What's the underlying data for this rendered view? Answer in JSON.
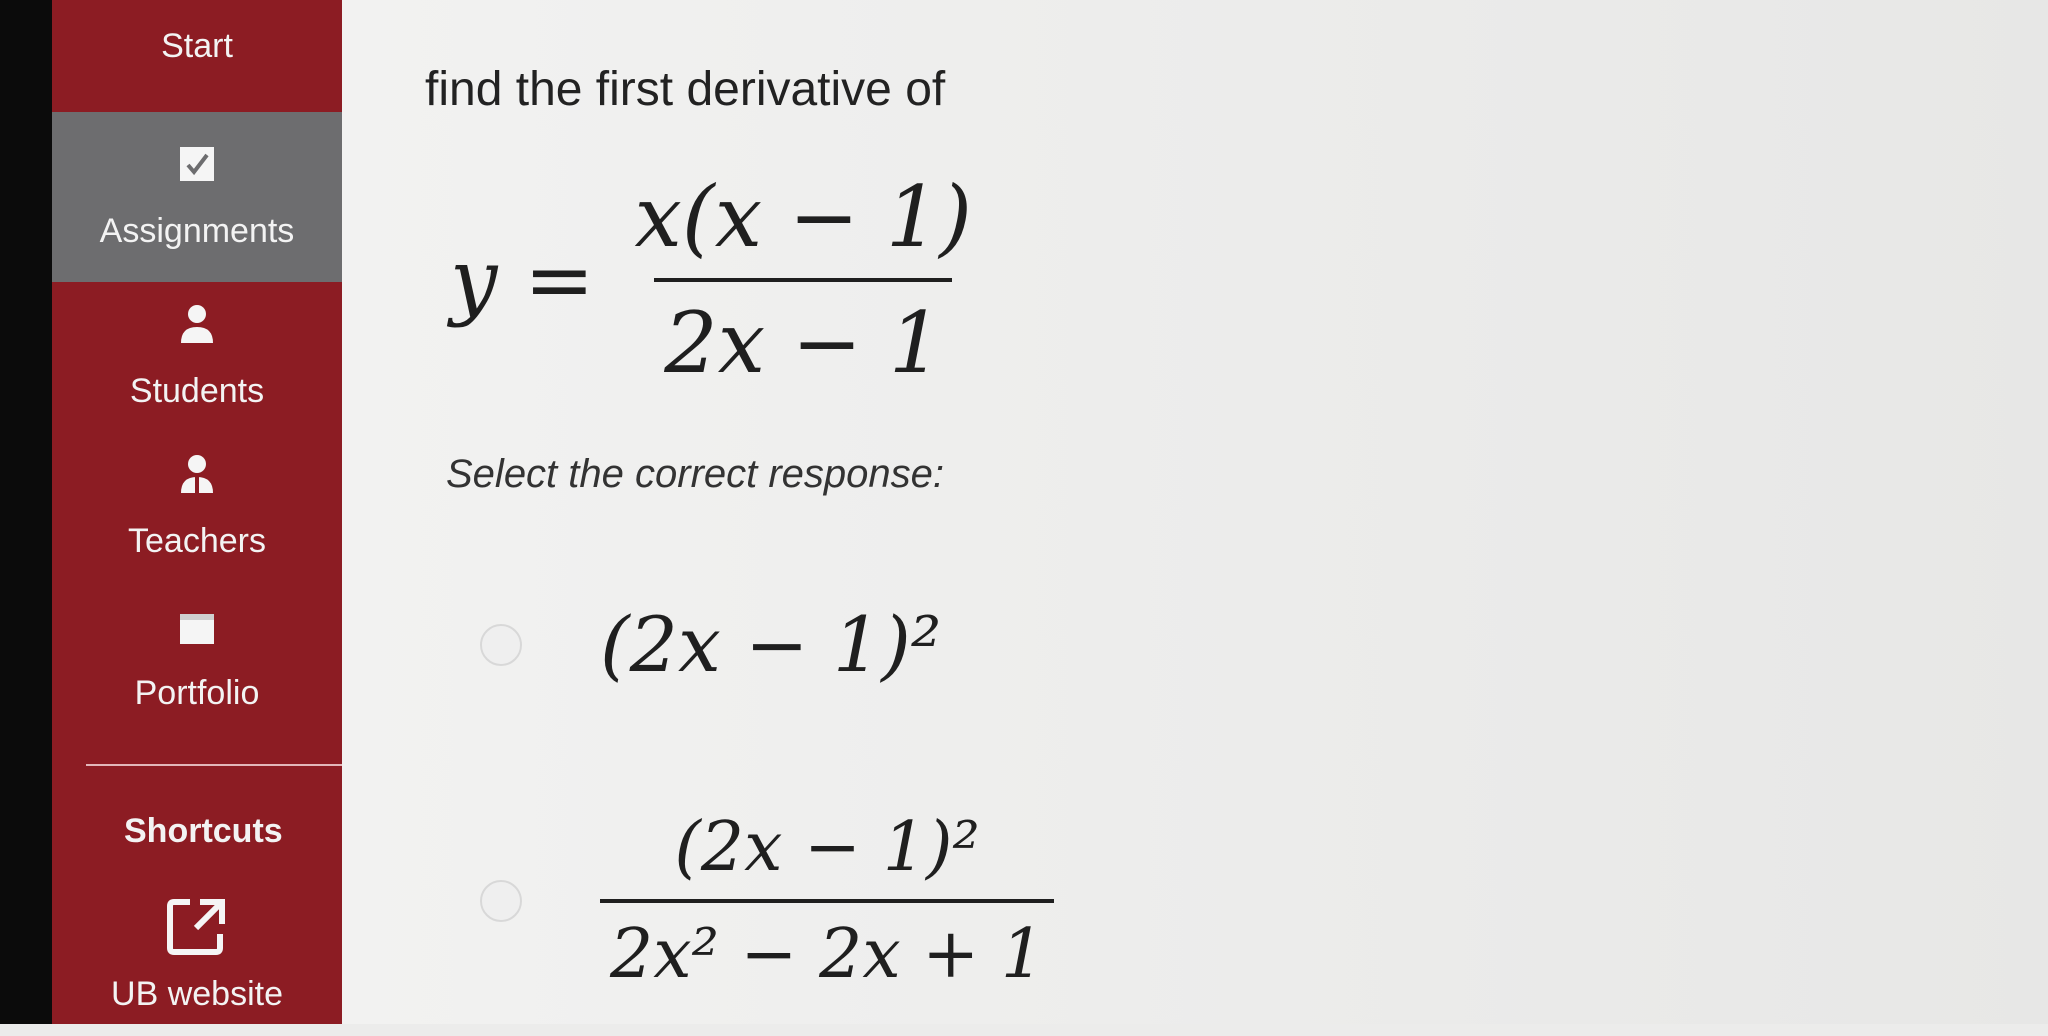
{
  "sidebar": {
    "items": [
      {
        "label": "Start",
        "icon": "start-icon"
      },
      {
        "label": "Assignments",
        "icon": "checkbox-icon"
      },
      {
        "label": "Students",
        "icon": "person-icon"
      },
      {
        "label": "Teachers",
        "icon": "teacher-icon"
      },
      {
        "label": "Portfolio",
        "icon": "folder-icon"
      }
    ],
    "shortcuts_title": "Shortcuts",
    "shortcuts": [
      {
        "label": "UB website",
        "icon": "external-link-icon"
      }
    ]
  },
  "question": {
    "prompt": "find the first derivative of",
    "equation": {
      "lhs": "y =",
      "numerator": "x(x − 1)",
      "denominator": "2x − 1"
    },
    "instruction": "Select the correct response:",
    "choices": [
      {
        "text": "(2x − 1)²"
      },
      {
        "numerator": "(2x − 1)²",
        "denominator": "2x² − 2x + 1"
      }
    ]
  },
  "colors": {
    "sidebar": "#8c1c23",
    "active_item": "#6d6d6f"
  }
}
